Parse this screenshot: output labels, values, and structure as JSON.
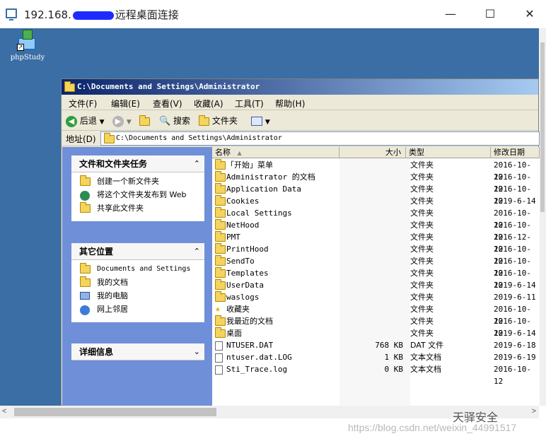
{
  "rdp": {
    "title_prefix": "192.168.",
    "title_suffix": "远程桌面连接",
    "minimize": "—",
    "maximize": "☐",
    "close": "✕"
  },
  "desktop": {
    "icon_label": "phpStudy"
  },
  "explorer": {
    "title": "C:\\Documents and Settings\\Administrator",
    "menu": [
      "文件(F)",
      "编辑(E)",
      "查看(V)",
      "收藏(A)",
      "工具(T)",
      "帮助(H)"
    ],
    "toolbar": {
      "back": "后退",
      "search": "搜索",
      "folders": "文件夹"
    },
    "address_label": "地址(D)",
    "address_value": "C:\\Documents and Settings\\Administrator",
    "tasks_panel": {
      "title": "文件和文件夹任务",
      "items": [
        "创建一个新文件夹",
        "将这个文件夹发布到 Web",
        "共享此文件夹"
      ]
    },
    "places_panel": {
      "title": "其它位置",
      "items": [
        "Documents and Settings",
        "我的文档",
        "我的电脑",
        "网上邻居"
      ]
    },
    "details_panel": {
      "title": "详细信息"
    },
    "columns": {
      "name": "名称",
      "size": "大小",
      "type": "类型",
      "date": "修改日期"
    },
    "files": [
      {
        "name": "「开始」菜单",
        "size": "",
        "type": "文件夹",
        "date": "2016-10-12",
        "icon": "folder"
      },
      {
        "name": "Administrator 的文档",
        "size": "",
        "type": "文件夹",
        "date": "2016-10-12",
        "icon": "folder"
      },
      {
        "name": "Application Data",
        "size": "",
        "type": "文件夹",
        "date": "2016-10-12",
        "icon": "folder"
      },
      {
        "name": "Cookies",
        "size": "",
        "type": "文件夹",
        "date": "2019-6-14",
        "icon": "folder"
      },
      {
        "name": "Local Settings",
        "size": "",
        "type": "文件夹",
        "date": "2016-10-12",
        "icon": "folder"
      },
      {
        "name": "NetHood",
        "size": "",
        "type": "文件夹",
        "date": "2016-10-12",
        "icon": "folder"
      },
      {
        "name": "PMT",
        "size": "",
        "type": "文件夹",
        "date": "2016-12-12",
        "icon": "folder"
      },
      {
        "name": "PrintHood",
        "size": "",
        "type": "文件夹",
        "date": "2016-10-12",
        "icon": "folder"
      },
      {
        "name": "SendTo",
        "size": "",
        "type": "文件夹",
        "date": "2016-10-12",
        "icon": "folder"
      },
      {
        "name": "Templates",
        "size": "",
        "type": "文件夹",
        "date": "2016-10-12",
        "icon": "folder"
      },
      {
        "name": "UserData",
        "size": "",
        "type": "文件夹",
        "date": "2019-6-14",
        "icon": "folder"
      },
      {
        "name": "waslogs",
        "size": "",
        "type": "文件夹",
        "date": "2019-6-11",
        "icon": "folder"
      },
      {
        "name": "收藏夹",
        "size": "",
        "type": "文件夹",
        "date": "2016-10-12",
        "icon": "star"
      },
      {
        "name": "我最近的文档",
        "size": "",
        "type": "文件夹",
        "date": "2016-10-12",
        "icon": "folder"
      },
      {
        "name": "桌面",
        "size": "",
        "type": "文件夹",
        "date": "2019-6-14",
        "icon": "folder"
      },
      {
        "name": "NTUSER.DAT",
        "size": "768 KB",
        "type": "DAT 文件",
        "date": "2019-6-18",
        "icon": "file"
      },
      {
        "name": "ntuser.dat.LOG",
        "size": "1 KB",
        "type": "文本文档",
        "date": "2019-6-19",
        "icon": "file"
      },
      {
        "name": "Sti_Trace.log",
        "size": "0 KB",
        "type": "文本文档",
        "date": "2016-10-12",
        "icon": "file"
      }
    ]
  },
  "watermark": "天驿安全",
  "csdn_url": "https://blog.csdn.net/weixin_44991517",
  "colors": {
    "desktop": "#3a6ea5",
    "title_gradient_start": "#0a246a",
    "title_gradient_end": "#a6caf0",
    "task_pane": "#6f8fd8"
  }
}
